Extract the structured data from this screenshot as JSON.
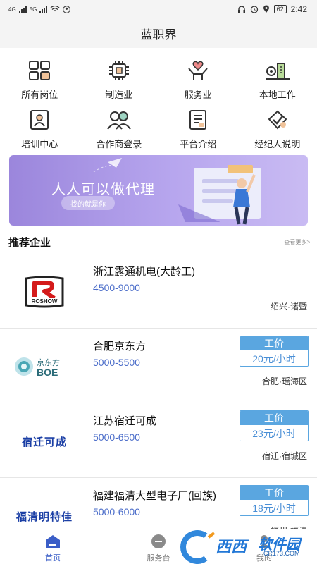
{
  "status_bar": {
    "time": "2:42",
    "battery": "62",
    "net_a": "4G",
    "net_b": "5G"
  },
  "app": {
    "title": "蓝职界"
  },
  "categories": [
    {
      "label": "所有岗位",
      "icon": "grid-icon"
    },
    {
      "label": "制造业",
      "icon": "chip-icon"
    },
    {
      "label": "服务业",
      "icon": "heart-hands-icon"
    },
    {
      "label": "本地工作",
      "icon": "location-building-icon"
    },
    {
      "label": "培训中心",
      "icon": "training-person-icon"
    },
    {
      "label": "合作商登录",
      "icon": "partners-icon"
    },
    {
      "label": "平台介绍",
      "icon": "document-icon"
    },
    {
      "label": "经纪人说明",
      "icon": "check-tag-icon"
    }
  ],
  "banner": {
    "title": "人人可以做代理",
    "subtitle": "找的就是你"
  },
  "section": {
    "title": "推荐企业",
    "more": "查看更多>"
  },
  "companies": [
    {
      "name": "浙江露通机电(大龄工)",
      "salary": "4500-9000",
      "location": "绍兴·诸暨",
      "logo_text": "ROSHOW"
    },
    {
      "name": "合肥京东方",
      "salary": "5000-5500",
      "location": "合肥·瑶海区",
      "wage_label": "工价",
      "wage": "20元/小时",
      "logo_text_cn": "京东方",
      "logo_text_en": "BOE"
    },
    {
      "name": "江苏宿迁可成",
      "salary": "5000-6500",
      "location": "宿迁·宿城区",
      "wage_label": "工价",
      "wage": "23元/小时",
      "logo_text": "宿迁可成"
    },
    {
      "name": "福建福清大型电子厂(回族)",
      "salary": "5000-6000",
      "location": "福州·福清",
      "wage_label": "工价",
      "wage": "18元/小时",
      "logo_text": "福清明特佳"
    }
  ],
  "tabs": [
    {
      "label": "首页"
    },
    {
      "label": "服务台"
    },
    {
      "label": "我的"
    }
  ],
  "watermark": {
    "brand": "西西",
    "suffix": "软件园",
    "url": "CR173.COM"
  },
  "colors": {
    "accent": "#3b5ec7",
    "salary": "#4a6cc9",
    "wage": "#5aa6e0",
    "banner": "#a996e6"
  }
}
